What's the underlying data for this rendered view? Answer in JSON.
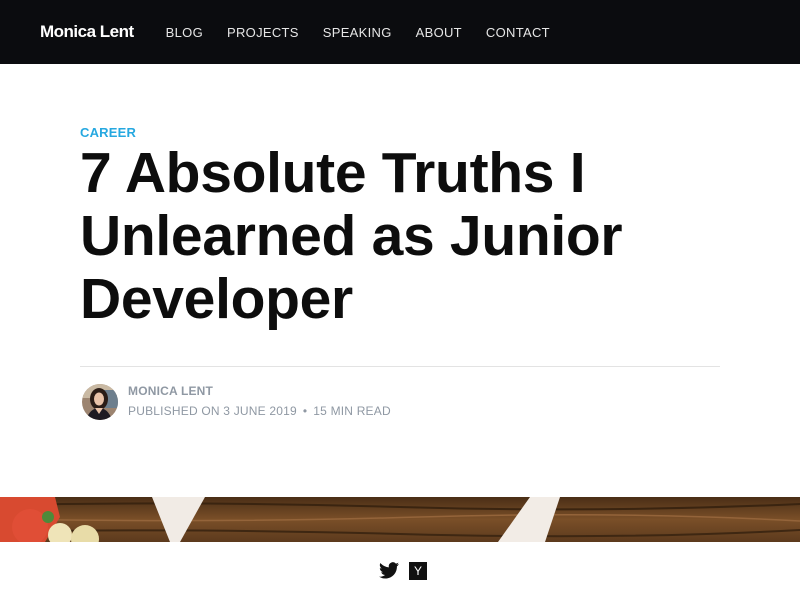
{
  "navbar": {
    "brand": "Monica Lent",
    "links": [
      "BLOG",
      "PROJECTS",
      "SPEAKING",
      "ABOUT",
      "CONTACT"
    ]
  },
  "article": {
    "category": "CAREER",
    "title": "7 Absolute Truths I Unlearned as Junior Developer",
    "author": "MONICA LENT",
    "published": "PUBLISHED ON 3 JUNE 2019",
    "separator": "•",
    "read_time": "15 MIN READ"
  },
  "share": {
    "icons": [
      "twitter-icon",
      "hacker-news-icon"
    ],
    "hn_label": "Y"
  },
  "colors": {
    "navbar_bg": "#0b0c0f",
    "category": "#26a8e0",
    "meta": "#8f98a3"
  }
}
